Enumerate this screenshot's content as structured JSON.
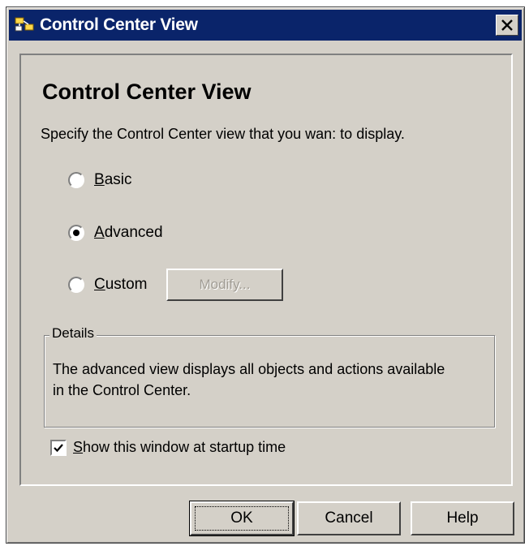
{
  "window": {
    "title": "Control Center View",
    "close_symbol": "×"
  },
  "panel": {
    "heading": "Control Center View",
    "instruction": "Specify the Control Center view that you wan: to display."
  },
  "options": [
    {
      "label": "Basic",
      "selected": false
    },
    {
      "label": "Advanced",
      "selected": true
    },
    {
      "label": "Custom",
      "selected": false
    }
  ],
  "modify_button": {
    "label": "Modify...",
    "enabled": false
  },
  "details": {
    "legend": "Details",
    "text": "The advanced view displays all objects and actions available in the Control Center."
  },
  "startup": {
    "label": "Show this window at startup time",
    "checked": true
  },
  "buttons": {
    "ok": "OK",
    "cancel": "Cancel",
    "help": "Help"
  },
  "icons": {
    "title": "window-icon",
    "close": "close-icon"
  },
  "colors": {
    "titlebar": "#0a246a",
    "dialog": "#d4d0c8"
  }
}
